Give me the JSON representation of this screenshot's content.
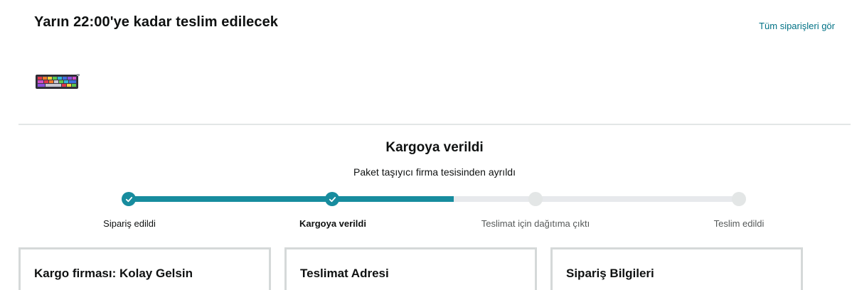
{
  "header": {
    "delivery_title": "Yarın 22:00'ye kadar teslim edilecek",
    "all_orders_link": "Tüm siparişleri gör"
  },
  "product": {
    "thumbnail_icon": "keyboard-thumbnail"
  },
  "status": {
    "title": "Kargoya verildi",
    "subtitle": "Paket taşıyıcı firma tesisinden ayrıldı",
    "progress_fraction": 0.533,
    "steps": [
      {
        "label": "Sipariş edildi",
        "state": "done"
      },
      {
        "label": "Kargoya verildi",
        "state": "current"
      },
      {
        "label": "Teslimat için dağıtıma çıktı",
        "state": "pending"
      },
      {
        "label": "Teslim edildi",
        "state": "pending"
      }
    ]
  },
  "cards": [
    {
      "title": "Kargo firması: Kolay Gelsin"
    },
    {
      "title": "Teslimat Adresi"
    },
    {
      "title": "Sipariş Bilgileri"
    }
  ],
  "colors": {
    "accent": "#178c9e",
    "link": "#007185",
    "track": "#e7e9ec",
    "border": "#d5d9d9"
  }
}
